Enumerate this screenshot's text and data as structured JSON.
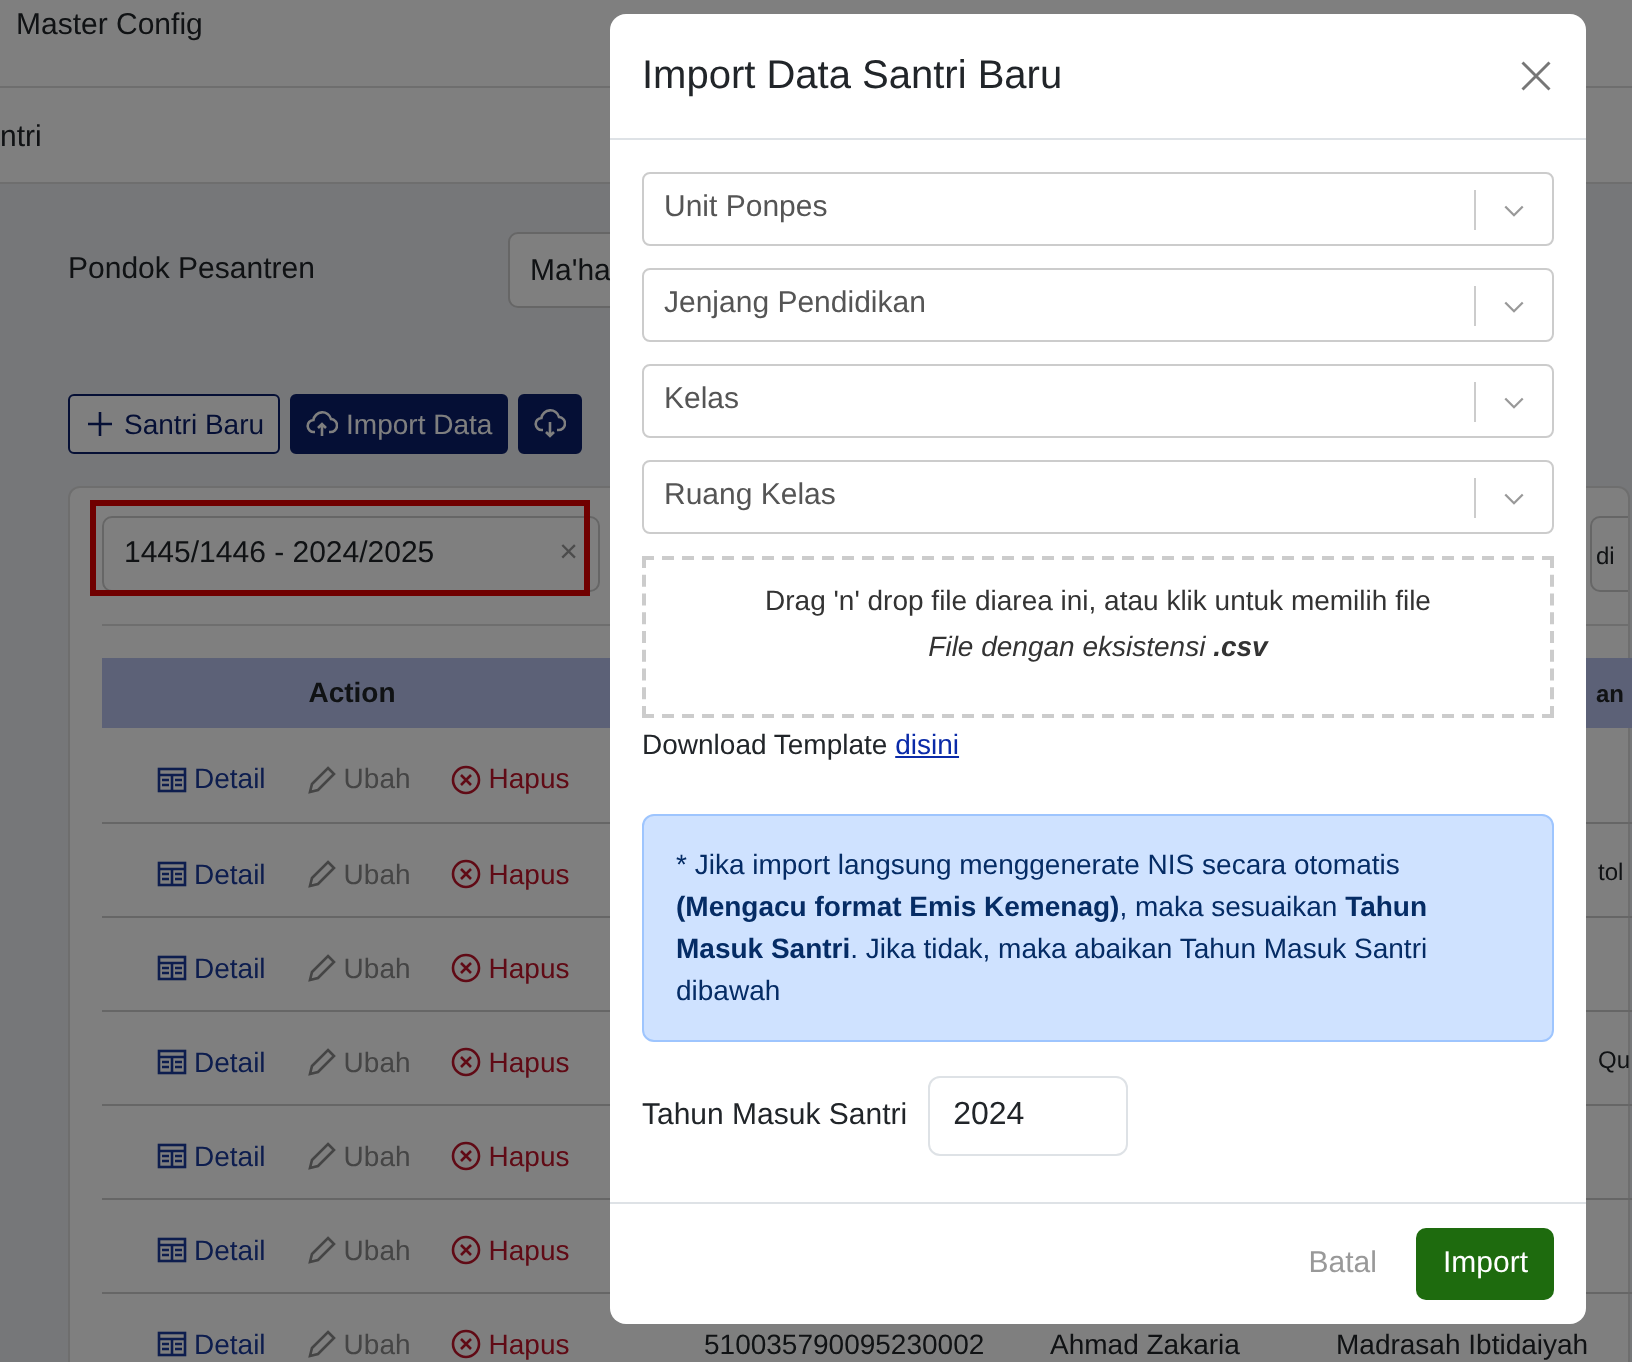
{
  "header": {
    "title": "Master Config"
  },
  "breadcrumb": {
    "text": "ntri"
  },
  "filter": {
    "label": "Pondok Pesantren",
    "value": "Ma'ha"
  },
  "toolbar": {
    "buttons": [
      {
        "kind": "outline",
        "label": "Santri Baru"
      },
      {
        "kind": "solid",
        "label": "Import Data"
      },
      {
        "kind": "solid"
      }
    ]
  },
  "year_select": {
    "value": "1445/1446 - 2024/2025",
    "clear": "×",
    "highlighted": true
  },
  "second_select": {
    "value": "di"
  },
  "table": {
    "header": {
      "column_1": "Action",
      "column_5": "an"
    },
    "rows": [
      {
        "actions": [
          {
            "kind": "detail",
            "label": "Detail"
          },
          {
            "kind": "edit",
            "label": "Ubah"
          },
          {
            "kind": "delete",
            "label": "Hapus"
          }
        ]
      },
      {
        "actions": [
          {
            "kind": "detail",
            "label": "Detail"
          },
          {
            "kind": "edit",
            "label": "Ubah"
          },
          {
            "kind": "delete",
            "label": "Hapus"
          }
        ],
        "column_5": "tol"
      },
      {
        "actions": [
          {
            "kind": "detail",
            "label": "Detail"
          },
          {
            "kind": "edit",
            "label": "Ubah"
          },
          {
            "kind": "delete",
            "label": "Hapus"
          }
        ]
      },
      {
        "actions": [
          {
            "kind": "detail",
            "label": "Detail"
          },
          {
            "kind": "edit",
            "label": "Ubah"
          },
          {
            "kind": "delete",
            "label": "Hapus"
          }
        ],
        "column_5": "Qu"
      },
      {
        "actions": [
          {
            "kind": "detail",
            "label": "Detail"
          },
          {
            "kind": "edit",
            "label": "Ubah"
          },
          {
            "kind": "delete",
            "label": "Hapus"
          }
        ]
      },
      {
        "actions": [
          {
            "kind": "detail",
            "label": "Detail"
          },
          {
            "kind": "edit",
            "label": "Ubah"
          },
          {
            "kind": "delete",
            "label": "Hapus"
          }
        ]
      },
      {
        "actions": [
          {
            "kind": "detail",
            "label": "Detail"
          },
          {
            "kind": "edit",
            "label": "Ubah"
          },
          {
            "kind": "delete",
            "label": "Hapus"
          }
        ],
        "column_2": "510035790095230002",
        "column_3": "Ahmad Zakaria",
        "column_4": "Madrasah Ibtidaiyah"
      }
    ]
  },
  "modal": {
    "title": "Import Data Santri Baru",
    "selects": [
      {
        "placeholder": "Unit Ponpes"
      },
      {
        "placeholder": "Jenjang Pendidikan"
      },
      {
        "placeholder": "Kelas"
      },
      {
        "placeholder": "Ruang Kelas"
      }
    ],
    "dropzone": {
      "line_1": "Drag 'n' drop file diarea ini, atau klik untuk memilih file",
      "line_2": "File dengan eksistensi **.csv**"
    },
    "download": {
      "text": "Download Template",
      "link": "disini"
    },
    "alert": "* Jika import langsung menggenerate NIS secara otomatis **(Mengacu format Emis Kemenag)**, maka sesuaikan **Tahun Masuk Santri**. Jika tidak, maka abaikan Tahun Masuk Santri dibawah",
    "field": {
      "label": "Tahun Masuk Santri",
      "value": "2024"
    },
    "buttons": [
      {
        "kind": "secondary",
        "label": "Batal"
      },
      {
        "kind": "primary",
        "label": "Import"
      }
    ]
  }
}
